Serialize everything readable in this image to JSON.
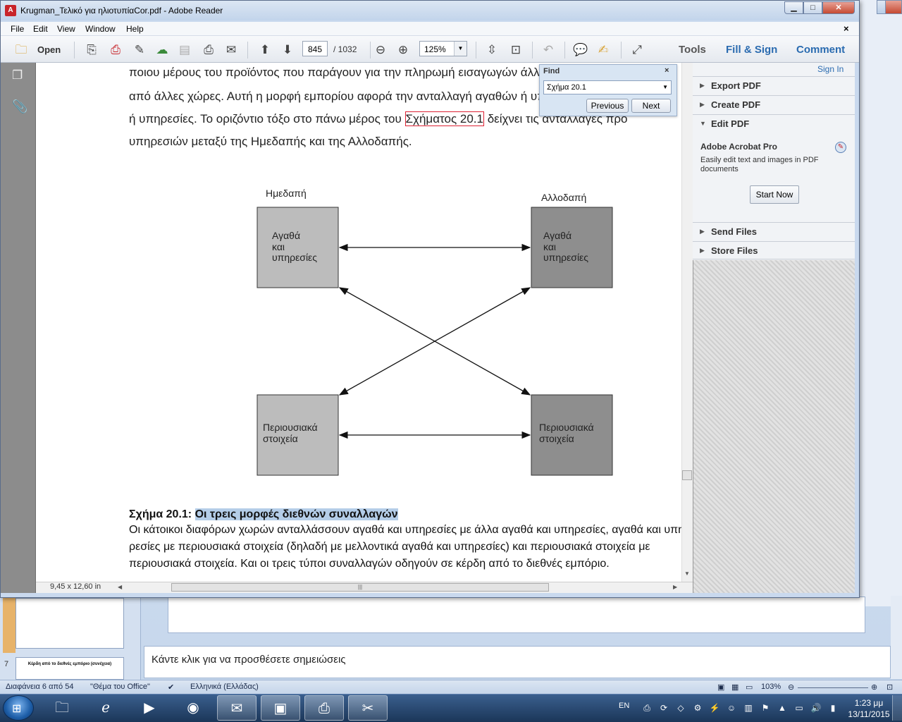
{
  "reader": {
    "title": "Krugman_Τελικό για ηλιοτυπίαCor.pdf - Adobe Reader",
    "menu": [
      "File",
      "Edit",
      "View",
      "Window",
      "Help"
    ],
    "toolbar": {
      "open_label": "Open",
      "page_current": "845",
      "page_total": "/ 1032",
      "zoom": "125%",
      "tools": "Tools",
      "fill_sign": "Fill & Sign",
      "comment": "Comment"
    },
    "find": {
      "label": "Find",
      "query": "Σχήμα 20.1",
      "previous": "Previous",
      "next": "Next"
    },
    "right_pane": {
      "sign_in": "Sign In",
      "sections": [
        "Export PDF",
        "Create PDF",
        "Edit PDF",
        "Send Files",
        "Store Files"
      ],
      "edit_pdf": {
        "title": "Adobe Acrobat Pro",
        "description": "Easily edit text and images in PDF documents",
        "start_now": "Start Now"
      }
    },
    "page_size": "9,45 x 12,60 in",
    "document": {
      "lines": [
        "ποιου μέρους του προϊόντος που παράγουν για την πληρωμή εισαγωγών άλλων προϊόντων  ",
        "από άλλες χώρες. Αυτή η μορφή εμπορίου αφορά την ανταλλαγή αγαθών ή υπηρεσιών",
        "ή υπηρεσίες. Το οριζόντιο τόξο στο πάνω μέρος του",
        "Σχήματος 20.1",
        " δείχνει τις ανταλλαγές προ",
        "υπηρεσιών μεταξύ της Ημεδαπής και της Αλλοδαπής."
      ],
      "figure": {
        "label_home": "Ημεδαπή",
        "label_foreign": "Αλλοδαπή",
        "box_goods_home": [
          "Αγαθά",
          "και",
          "υπηρεσίες"
        ],
        "box_goods_foreign": [
          "Αγαθά",
          "και",
          "υπηρεσίες"
        ],
        "box_assets_home": [
          "Περιουσιακά",
          "στοιχεία"
        ],
        "box_assets_foreign": [
          "Περιουσιακά",
          "στοιχεία"
        ],
        "colors": {
          "home_box": "#bcbcbc",
          "foreign_box": "#8e8e8e"
        }
      },
      "caption_prefix": "Σχήμα 20.1: ",
      "caption_title": "Οι τρεις μορφές διεθνών συναλλαγών",
      "caption_lines": [
        "Οι κάτοικοι διαφόρων χωρών ανταλλάσσουν αγαθά και υπηρεσίες με άλλα αγαθά και υπηρεσίες, αγαθά και υπη-",
        "ρεσίες με περιουσιακά στοιχεία (δηλαδή με μελλοντικά αγαθά και υπηρεσίες) και περιουσιακά στοιχεία με",
        "περιουσιακά στοιχεία. Και οι τρεις τύποι συναλλαγών οδηγούν σε κέρδη από το διεθνές εμπόριο."
      ]
    }
  },
  "powerpoint": {
    "notes_placeholder": "Κάντε κλικ για να προσθέσετε σημειώσεις",
    "thumb7_number": "7",
    "thumb7_title": "Κέρδη από το διεθνές εμπόριο (συνέχεια)",
    "status": {
      "slide": "Διαφάνεια 6 από 54",
      "theme": "\"Θέμα του Office\"",
      "language": "Ελληνικά (Ελλάδας)",
      "zoom": "103%"
    }
  },
  "taskbar": {
    "lang": "EN",
    "time": "1:23 μμ",
    "date": "13/11/2015"
  }
}
